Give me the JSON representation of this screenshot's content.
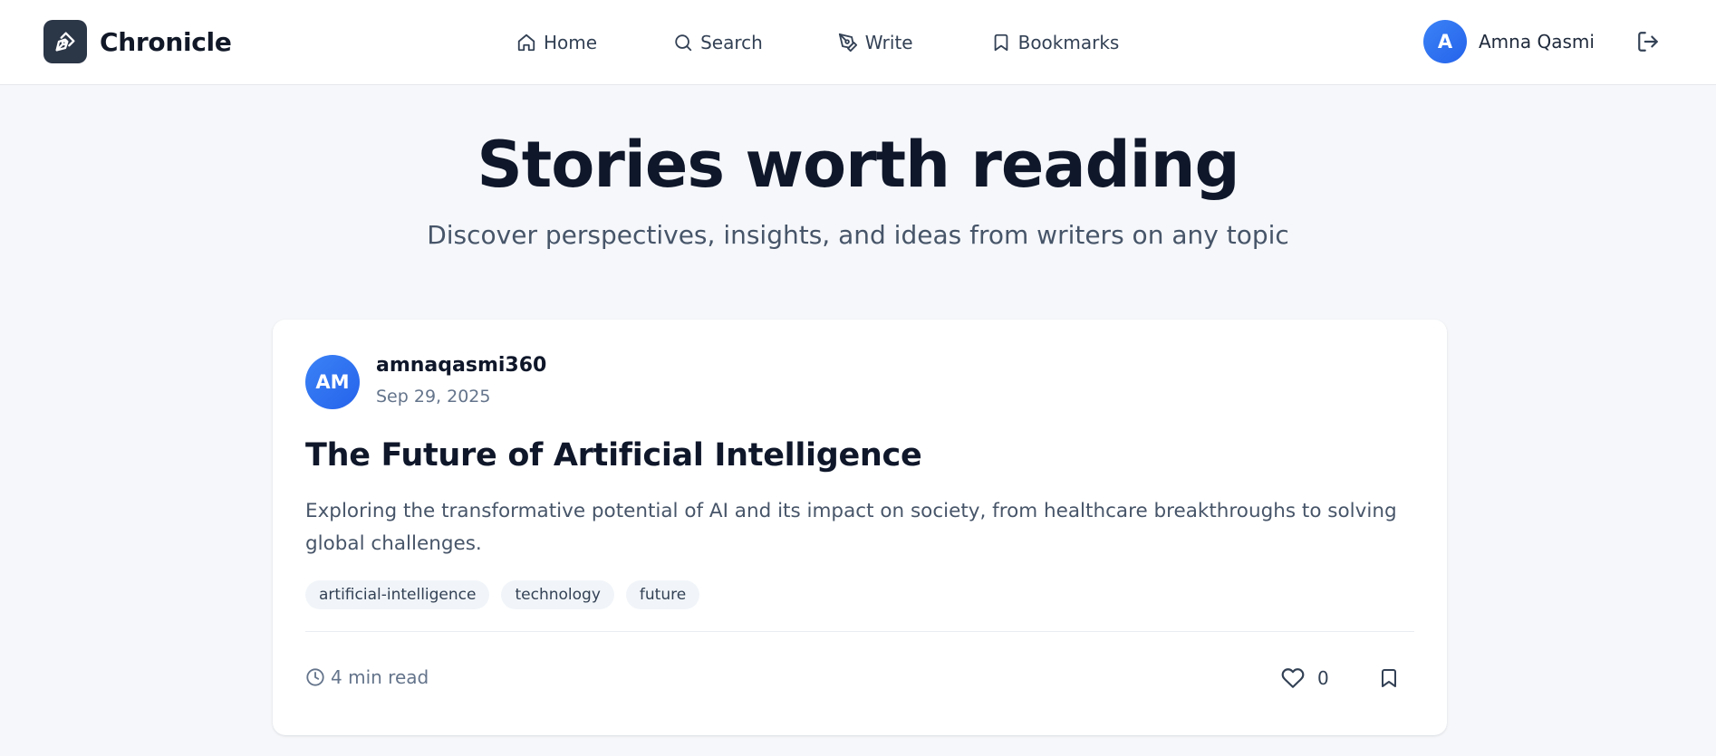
{
  "header": {
    "brand": {
      "name": "Chronicle",
      "icon": "pen-tool-icon",
      "icon_bg": "#2b3647"
    },
    "nav": [
      {
        "label": "Home",
        "icon": "home-icon"
      },
      {
        "label": "Search",
        "icon": "search-icon"
      },
      {
        "label": "Write",
        "icon": "pen-tool-icon"
      },
      {
        "label": "Bookmarks",
        "icon": "bookmark-icon"
      }
    ],
    "user": {
      "initial": "A",
      "name": "Amna Qasmi",
      "avatar_color": "#3b82f6"
    },
    "logout_icon": "log-out-icon"
  },
  "hero": {
    "title": "Stories worth reading",
    "subtitle": "Discover perspectives, insights, and ideas from writers on any topic"
  },
  "posts": [
    {
      "author": {
        "initials": "AM",
        "username": "amnaqasmi360"
      },
      "date": "Sep 29, 2025",
      "title": "The Future of Artificial Intelligence",
      "excerpt": "Exploring the transformative potential of AI and its impact on society, from healthcare breakthroughs to solving global challenges.",
      "tags": [
        "artificial-intelligence",
        "technology",
        "future"
      ],
      "read_time": "4 min read",
      "likes": "0",
      "icons": {
        "clock": "clock-icon",
        "like": "heart-icon",
        "bookmark": "bookmark-icon"
      }
    }
  ],
  "colors": {
    "page_bg": "#f5f7fa",
    "card_bg": "#ffffff",
    "accent": "#3b82f6",
    "text_primary": "#0f172a",
    "text_muted": "#64748b"
  }
}
